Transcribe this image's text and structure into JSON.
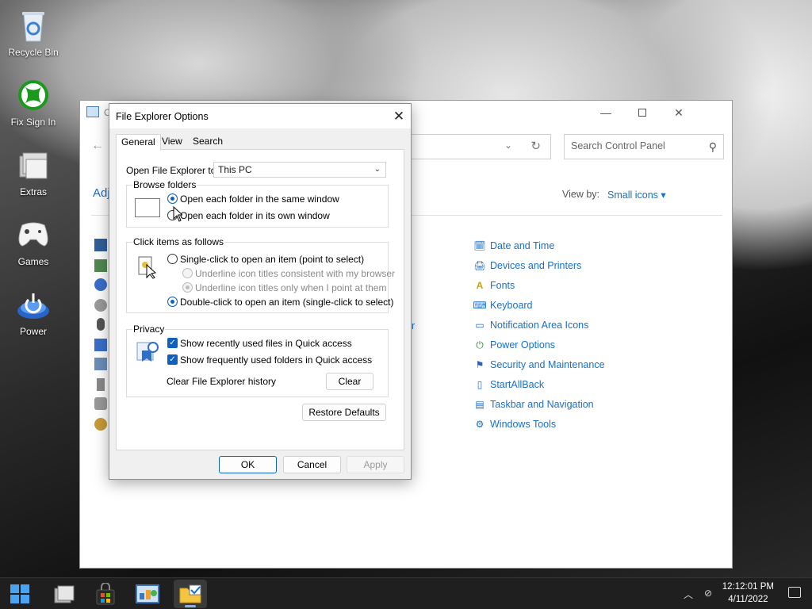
{
  "desktop": {
    "icons": [
      {
        "label": "Recycle Bin",
        "icon": "recycle-bin-icon"
      },
      {
        "label": "Fix Sign In",
        "icon": "xbox-icon"
      },
      {
        "label": "Extras",
        "icon": "folder-stack-icon"
      },
      {
        "label": "Games",
        "icon": "gamepad-icon"
      },
      {
        "label": "Power",
        "icon": "power-icon"
      }
    ]
  },
  "control_panel": {
    "title_partial": "C",
    "search_placeholder": "Search Control Panel",
    "heading_partial": "Adj",
    "view_by_label": "View by:",
    "view_by_value": "Small icons ▾",
    "items": [
      {
        "label": "Date and Time",
        "icon": "clock-calendar-icon"
      },
      {
        "label": "Devices and Printers",
        "icon": "printer-icon"
      },
      {
        "label": "Fonts",
        "icon": "fonts-icon"
      },
      {
        "label": "Keyboard",
        "icon": "keyboard-icon"
      },
      {
        "label": "Notification Area Icons",
        "icon": "notification-area-icon"
      },
      {
        "label": "Power Options",
        "icon": "power-options-icon"
      },
      {
        "label": "Security and Maintenance",
        "icon": "flag-icon"
      },
      {
        "label": "StartAllBack",
        "icon": "startallback-icon"
      },
      {
        "label": "Taskbar and Navigation",
        "icon": "taskbar-icon"
      },
      {
        "label": "Windows Tools",
        "icon": "windows-tools-icon"
      }
    ],
    "stray_fragments": [
      "er",
      "l"
    ]
  },
  "dialog": {
    "title": "File Explorer Options",
    "tabs": [
      "General",
      "View",
      "Search"
    ],
    "open_to_label": "Open File Explorer to:",
    "open_to_value": "This PC",
    "browse_group": {
      "title": "Browse folders",
      "options": [
        "Open each folder in the same window",
        "Open each folder in its own window"
      ],
      "selected": 0
    },
    "click_group": {
      "title": "Click items as follows",
      "single_click": "Single-click to open an item (point to select)",
      "underline_consistent": "Underline icon titles consistent with my browser",
      "underline_hover": "Underline icon titles only when I point at them",
      "double_click": "Double-click to open an item (single-click to select)"
    },
    "privacy_group": {
      "title": "Privacy",
      "recent_files": "Show recently used files in Quick access",
      "frequent_folders": "Show frequently used folders in Quick access",
      "clear_history_label": "Clear File Explorer history",
      "clear_button": "Clear"
    },
    "restore_defaults": "Restore Defaults",
    "ok": "OK",
    "cancel": "Cancel",
    "apply": "Apply"
  },
  "taskbar": {
    "time": "12:12:01 PM",
    "date": "4/11/2022",
    "accent": "#7cb7f5"
  }
}
